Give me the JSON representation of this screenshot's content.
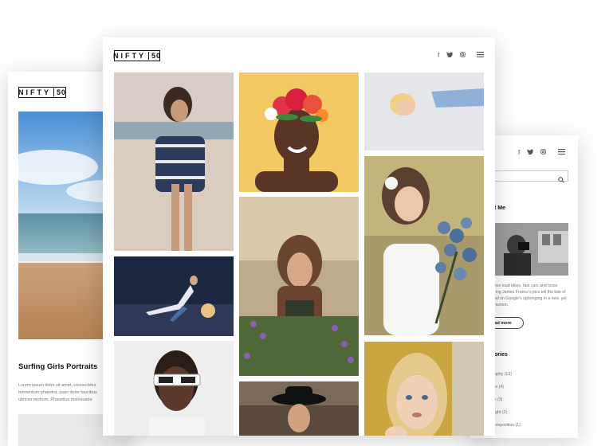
{
  "left_card": {
    "logo_text": "NIFTY",
    "logo_num": "50",
    "post_title": "Surfing Girls Portraits",
    "excerpt": [
      "Lorem ipsum dolor sit amet, consectetur",
      "fermentum pharetra, justo dolor faucibus",
      "ultrices pretium. Phasellus malesuada"
    ]
  },
  "main_card": {
    "logo_text": "NIFTY",
    "logo_num": "50",
    "social_icons": [
      "facebook-icon",
      "twitter-icon",
      "instagram-icon"
    ],
    "menu_icon": "hamburger-menu-icon"
  },
  "right_card": {
    "social_icons": [
      "facebook-icon",
      "twitter-icon",
      "instagram-icon"
    ],
    "menu_icon": "hamburger-menu-icon",
    "search_icon": "search-icon",
    "about_heading": "t Me",
    "about_text": [
      "ove loud bikes, fast cars and loose",
      "ring James Franco's pics tell the tale of",
      "ad on Google's upbringing in a new, yet",
      "fashion."
    ],
    "read_more": "ad more",
    "categories_heading": "ories",
    "categories": [
      "aphy (13)",
      "te (4)",
      "s (3)",
      "ight (2)",
      "omposition (1)"
    ]
  },
  "colors": {
    "accent": "#111111",
    "muted_text": "#777777"
  }
}
